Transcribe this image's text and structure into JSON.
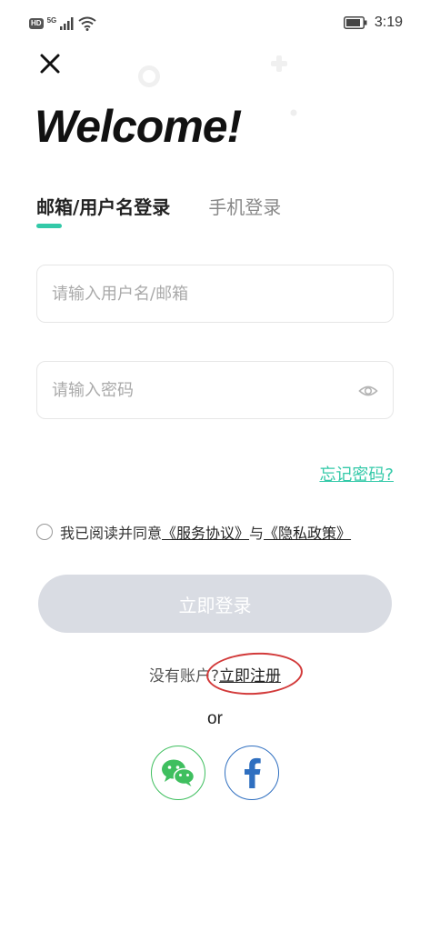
{
  "status_bar": {
    "hd": "HD",
    "network": "5G",
    "time": "3:19"
  },
  "header": {
    "welcome": "Welcome!"
  },
  "tabs": [
    {
      "label": "邮箱/用户名登录",
      "active": true
    },
    {
      "label": "手机登录",
      "active": false
    }
  ],
  "form": {
    "username_placeholder": "请输入用户名/邮箱",
    "password_placeholder": "请输入密码",
    "forgot_label": "忘记密码?"
  },
  "agreement": {
    "prefix": "我已阅读并同意",
    "service_link": "《服务协议》",
    "joiner": "与",
    "privacy_link": "《隐私政策》"
  },
  "login_button": "立即登录",
  "register": {
    "prompt": "没有账户?",
    "link": "立即注册"
  },
  "or_text": "or",
  "social": [
    {
      "name": "wechat",
      "icon": "wechat-icon",
      "color": "#3fbf5f"
    },
    {
      "name": "facebook",
      "icon": "facebook-icon",
      "color": "#2f6fc0"
    }
  ],
  "colors": {
    "accent": "#33c9a8",
    "button_disabled": "#d9dce3",
    "annotation": "#d23a3a"
  }
}
